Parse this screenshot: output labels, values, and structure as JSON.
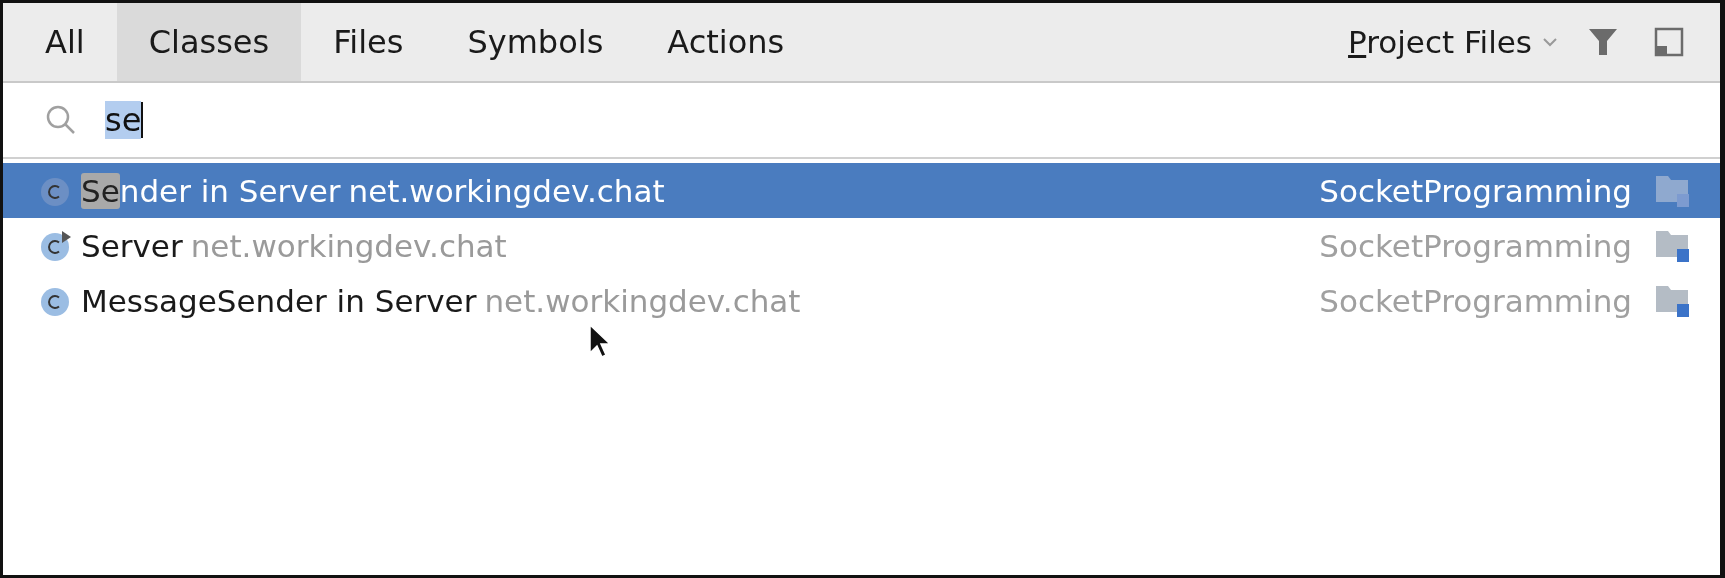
{
  "tabs": [
    {
      "label": "All",
      "selected": false
    },
    {
      "label": "Classes",
      "selected": true
    },
    {
      "label": "Files",
      "selected": false
    },
    {
      "label": "Symbols",
      "selected": false
    },
    {
      "label": "Actions",
      "selected": false
    }
  ],
  "scope": {
    "label": "Project Files"
  },
  "search": {
    "value": "se"
  },
  "results": [
    {
      "kind": "class",
      "match": "Se",
      "name": "nder",
      "container": "in Server",
      "package": "net.workingdev.chat",
      "module": "SocketProgramming",
      "selected": true
    },
    {
      "kind": "main-class",
      "name": "Server",
      "package": "net.workingdev.chat",
      "module": "SocketProgramming",
      "selected": false
    },
    {
      "kind": "class",
      "name": "MessageSender",
      "container": "in Server",
      "package": "net.workingdev.chat",
      "module": "SocketProgramming",
      "selected": false
    }
  ]
}
